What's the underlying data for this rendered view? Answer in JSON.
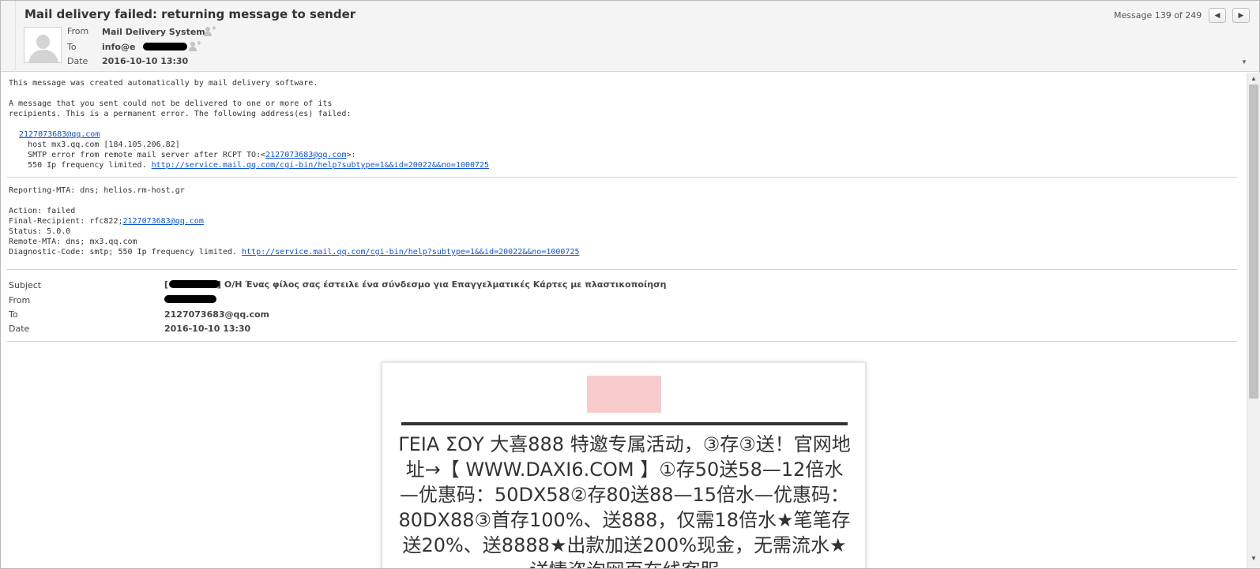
{
  "header": {
    "subject": "Mail delivery failed: returning message to sender",
    "from_label": "From",
    "from_value": "Mail Delivery System",
    "to_label": "To",
    "to_value": "info@e",
    "date_label": "Date",
    "date_value": "2016-10-10 13:30",
    "message_counter": "Message 139 of 249",
    "prev_icon": "◀",
    "next_icon": "▶"
  },
  "body": {
    "line1": "This message was created automatically by mail delivery software.",
    "line2": "A message that you sent could not be delivered to one or more of its",
    "line3": "recipients. This is a permanent error. The following address(es) failed:",
    "failed_address": "2127073683@qq.com",
    "host_line": "    host mx3.qq.com [184.105.206.82]",
    "smtp_prefix": "    SMTP error from remote mail server after RCPT TO:<",
    "smtp_address": "2127073683@qq.com",
    "smtp_suffix": ">:",
    "error_prefix": "    550 Ip frequency limited. ",
    "help_link": "http://service.mail.qq.com/cgi-bin/help?subtype=1&&id=20022&&no=1000725",
    "reporting_mta": "Reporting-MTA: dns; helios.rm-host.gr",
    "action": "Action: failed",
    "final_recipient_prefix": "Final-Recipient: rfc822;",
    "final_recipient_address": "2127073683@qq.com",
    "status": "Status: 5.0.0",
    "remote_mta": "Remote-MTA: dns; mx3.qq.com",
    "diagnostic_prefix": "Diagnostic-Code: smtp; 550 Ip frequency limited. ",
    "diagnostic_link": "http://service.mail.qq.com/cgi-bin/help?subtype=1&&id=20022&&no=1000725"
  },
  "original": {
    "subject_label": "Subject",
    "subject_open": "[",
    "subject_close": "]",
    "subject_text": "Ο/Η Ένας φίλος σας έστειλε ένα σύνδεσμο για Επαγγελματικές Κάρτες με πλαστικοποίηση",
    "from_label": "From",
    "to_label": "To",
    "to_value": "2127073683@qq.com",
    "date_label": "Date",
    "date_value": "2016-10-10 13:30"
  },
  "card": {
    "text": "ΓΕΙΑ ΣΟΥ 大喜888 特邀专属活动，③存③送！官网地址→【 WWW.DAXI6.COM 】①存50送58—12倍水—优惠码：50DX58②存80送88—15倍水—优惠码：80DX88③首存100%、送888，仅需18倍水★笔笔存送20%、送8888★出款加送200%现金，无需流水★详情咨询网页在线客服"
  },
  "scrollbar": {
    "up_icon": "▲",
    "down_icon": "▼"
  },
  "collapse_icon": "▼"
}
